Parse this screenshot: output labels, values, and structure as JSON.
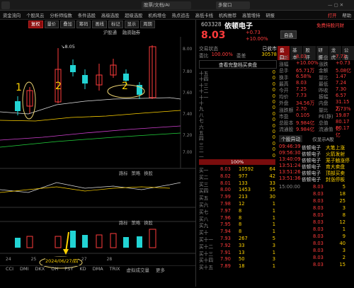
{
  "topbar": {
    "search": "股票/文档/AI",
    "ai": "AI",
    "notice": "多窗口",
    "logo": "问",
    "flag": "Flag",
    "buy": "买"
  },
  "menu": [
    "资金流向",
    "个股风云",
    "分析师指数",
    "条件选股",
    "高级选股",
    "超级选股",
    "机构增仓",
    "热点追击",
    "高低卡线",
    "机构推荐",
    "高管增持",
    "研报"
  ],
  "menu_right": {
    "left": "打开",
    "right": "帮助"
  },
  "toolbar": [
    "复权",
    "量价",
    "叠加",
    "筹码",
    "画线",
    "标记",
    "显示",
    "周期"
  ],
  "subtabs": [
    "沪股通",
    "融资融券"
  ],
  "kline": {
    "high_label": "8.05",
    "annot1": "1",
    "annot2": "2",
    "annot3": "2",
    "y_ticks": [
      "8.00",
      "7.80",
      "7.60",
      "7.40",
      "7.20",
      "7.00"
    ]
  },
  "macd_label": "MACD",
  "indicator_row1": [
    "路标",
    "策略",
    "换股"
  ],
  "indicator_row2": [
    "路标",
    "策略",
    "换股"
  ],
  "bottom_date": "2024/06/27/四",
  "bottom_tabs": [
    "CCI",
    "DMI",
    "DKX",
    "OH",
    "PSY",
    "KD",
    "DMA",
    "TRIX",
    "虚拟成交量",
    "更多"
  ],
  "xticks": [
    "24",
    "25",
    "26",
    "27",
    "28"
  ],
  "stock": {
    "code": "603328",
    "name": "依顿电子",
    "price": "8.03",
    "change": "+0.73",
    "pct": "+10.00%",
    "free_tag": "自选",
    "nav_f10": "F10",
    "badge": "0",
    "scroll": "免费持股问财"
  },
  "trade": {
    "type_label": "交易状态",
    "type_value": "已收市",
    "ratio_label": "委比",
    "ratio_value": "100.00%",
    "diff_label": "委差",
    "diff_value": "30578",
    "btn": "查看完整档买卖盘"
  },
  "sell_levels": [
    "十五",
    "十四",
    "十三",
    "十二",
    "十一",
    "十",
    "九",
    "八",
    "七",
    "六",
    "五",
    "四",
    "三",
    "二",
    "一"
  ],
  "sell_zero": "0",
  "buy_pct": "100%",
  "buy_levels": [
    {
      "l": "买一",
      "p": "8.03",
      "v": "10592"
    },
    {
      "l": "买二",
      "p": "8.02",
      "v": "977"
    },
    {
      "l": "买三",
      "p": "8.01",
      "v": "133"
    },
    {
      "l": "买四",
      "p": "8.00",
      "v": "1453"
    },
    {
      "l": "买五",
      "p": "7.99",
      "v": "213"
    },
    {
      "l": "买六",
      "p": "7.98",
      "v": "12"
    },
    {
      "l": "买七",
      "p": "7.97",
      "v": "8"
    },
    {
      "l": "买八",
      "p": "7.96",
      "v": "8"
    },
    {
      "l": "买九",
      "p": "7.95",
      "v": "8"
    },
    {
      "l": "买十",
      "p": "7.94",
      "v": "8"
    },
    {
      "l": "买十一",
      "p": "7.93",
      "v": "267"
    },
    {
      "l": "买十二",
      "p": "7.92",
      "v": "33"
    },
    {
      "l": "买十三",
      "p": "7.91",
      "v": "13"
    },
    {
      "l": "买十四",
      "p": "7.90",
      "v": "50"
    },
    {
      "l": "买十五",
      "p": "7.89",
      "v": "18"
    }
  ],
  "buy_extra": [
    "64",
    "42",
    "33",
    "35",
    "30",
    "1",
    "1",
    "1",
    "1",
    "1",
    "5",
    "3",
    "1",
    "3",
    "1"
  ],
  "tabs_right": [
    "盘口",
    "基本",
    "股评",
    "研报",
    "龙虎",
    "公告"
  ],
  "quote": [
    {
      "k": "最新",
      "v": "8.03",
      "k2": "开盘",
      "v2": "7.73"
    },
    {
      "k": "涨幅",
      "v": "+10.00%",
      "k2": "涨跌",
      "v2": "+0.73"
    },
    {
      "k": "总手",
      "v": "65.71万",
      "k2": "金额",
      "v2": "5.08亿"
    },
    {
      "k": "换手",
      "v": "6.58%",
      "k2": "量比",
      "v2": "1.47"
    },
    {
      "k": "最高",
      "v": "8.03",
      "k2": "最低",
      "v2": "7.24"
    },
    {
      "k": "今开",
      "v": "7.25",
      "k2": "昨收",
      "v2": "7.30"
    },
    {
      "k": "均价",
      "v": "7.73",
      "k2": "振幅",
      "v2": "6.57"
    },
    {
      "k": "外盘",
      "v": "34.56万",
      "k2": "内盘",
      "v2": "31.15万"
    },
    {
      "k": "涨跌额",
      "v": "2.70",
      "k2": "量比",
      "v2": "2.73%"
    },
    {
      "k": "市盈",
      "v": "0.105",
      "k2": "PE(静)",
      "v2": "19.87"
    },
    {
      "k": "总股本",
      "v": "9.984亿",
      "k2": "总值",
      "v2": "80.17亿"
    },
    {
      "k": "流通股",
      "v": "9.984亿",
      "k2": "流通值",
      "v2": "80.17亿"
    }
  ],
  "detail_title": "个股异动",
  "detail_filter": "仅显示A股",
  "events": [
    {
      "t": "09:46:39",
      "n": "依顿电子",
      "e": "大笔上涨"
    },
    {
      "t": "09:56:30",
      "n": "依顿电子",
      "e": "火箭发射"
    },
    {
      "t": "13:40:09",
      "n": "依顿电子",
      "e": "笼子触涨停"
    },
    {
      "t": "13:51:24",
      "n": "依顿电子",
      "e": "育大卖盘"
    },
    {
      "t": "13:51:26",
      "n": "依顿电子",
      "e": "顶部买卖"
    },
    {
      "t": "13:51:36",
      "n": "依顿电子",
      "e": "封涨停板"
    }
  ],
  "ticks": [
    {
      "t": "15:00:00",
      "p": "8.03",
      "v": "5"
    },
    {
      "t": "",
      "p": "8.03",
      "v": "18"
    },
    {
      "t": "",
      "p": "8.03",
      "v": "25"
    },
    {
      "t": "",
      "p": "8.03",
      "v": "3"
    },
    {
      "t": "",
      "p": "8.03",
      "v": "8"
    },
    {
      "t": "",
      "p": "8.03",
      "v": "12"
    },
    {
      "t": "",
      "p": "8.03",
      "v": "1"
    },
    {
      "t": "",
      "p": "8.03",
      "v": "9"
    },
    {
      "t": "",
      "p": "8.03",
      "v": "40"
    },
    {
      "t": "",
      "p": "8.03",
      "v": "3"
    },
    {
      "t": "",
      "p": "8.03",
      "v": "2"
    },
    {
      "t": "",
      "p": "8.03",
      "v": "15"
    }
  ]
}
